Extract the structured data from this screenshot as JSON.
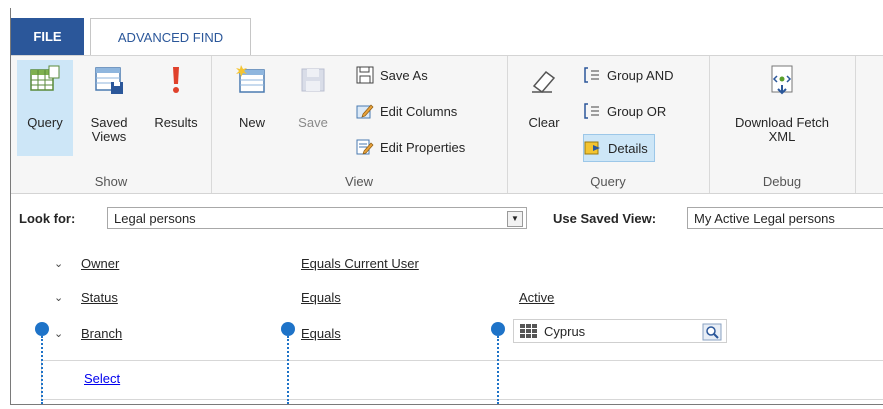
{
  "tabs": {
    "file": "FILE",
    "advanced_find": "ADVANCED FIND"
  },
  "ribbon": {
    "show": {
      "label": "Show",
      "query": "Query",
      "saved_views": "Saved\nViews",
      "results": "Results"
    },
    "view": {
      "label": "View",
      "new": "New",
      "save": "Save",
      "save_as": "Save As",
      "edit_columns": "Edit Columns",
      "edit_properties": "Edit Properties"
    },
    "query": {
      "label": "Query",
      "clear": "Clear",
      "group_and": "Group AND",
      "group_or": "Group OR",
      "details": "Details"
    },
    "debug": {
      "label": "Debug",
      "download_fetch": "Download Fetch\nXML"
    }
  },
  "look_for": {
    "label": "Look for:",
    "value": "Legal persons"
  },
  "saved_view": {
    "label": "Use Saved View:",
    "value": "My Active Legal persons"
  },
  "conditions": [
    {
      "field": "Owner",
      "operator": "Equals Current User",
      "value": ""
    },
    {
      "field": "Status",
      "operator": "Equals",
      "value": "Active"
    },
    {
      "field": "Branch",
      "operator": "Equals",
      "value": "Cyprus"
    }
  ],
  "select_link": "Select",
  "colors": {
    "accent": "#2b579a",
    "callout": "#1e73c8",
    "selected": "#cde6f7"
  }
}
